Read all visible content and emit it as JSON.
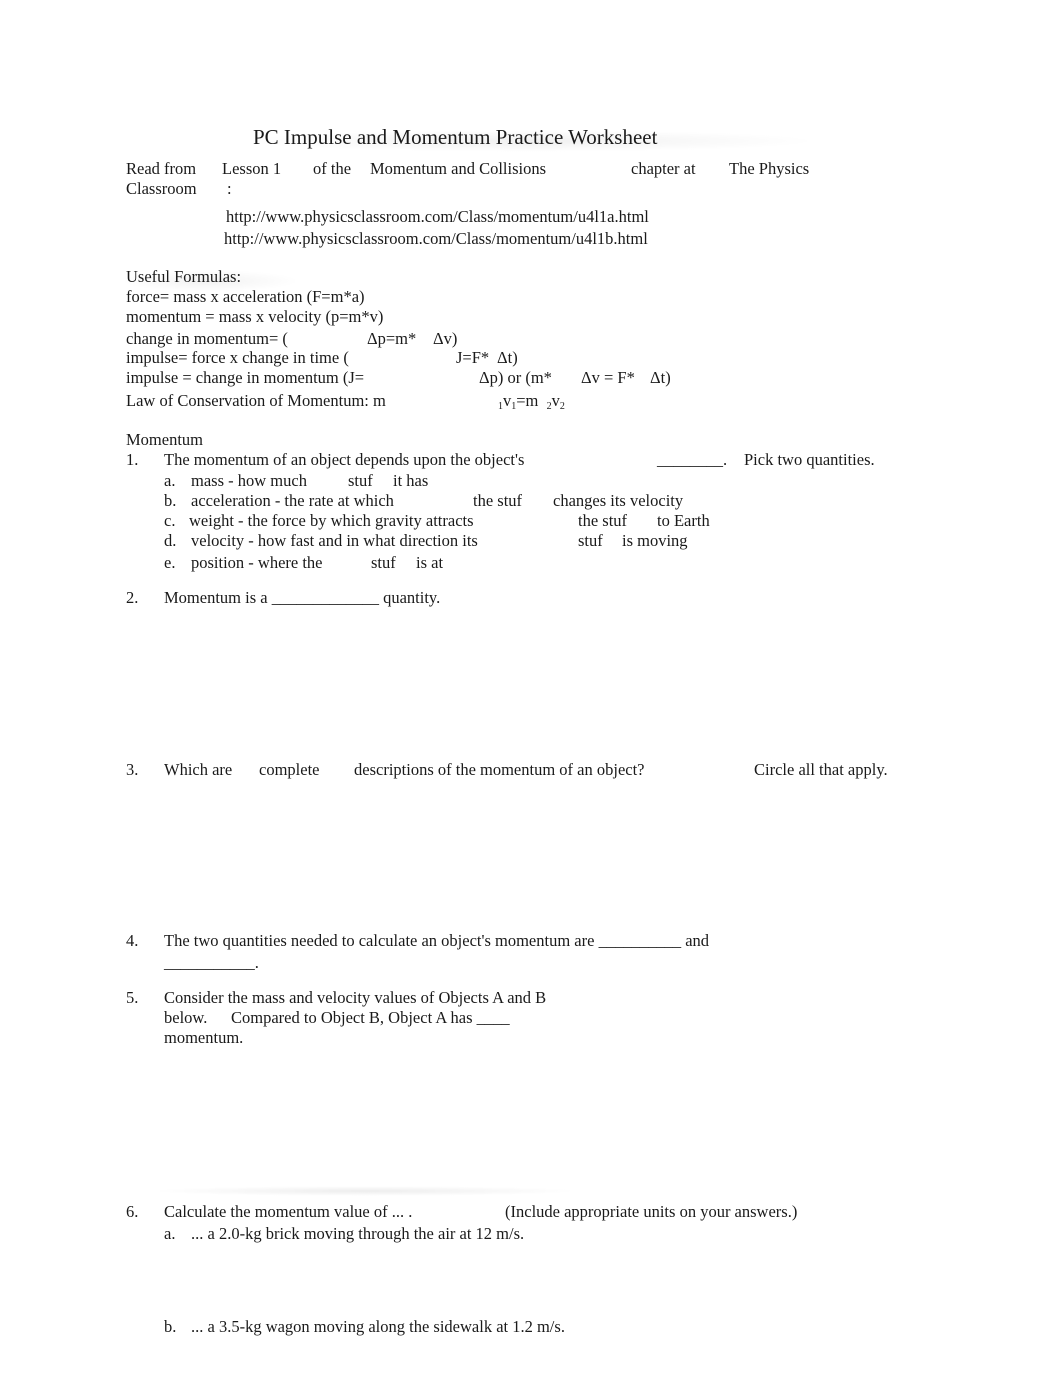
{
  "document": {
    "title": "PC Impulse and Momentum Practice Worksheet",
    "intro": {
      "read_from": "Read from",
      "lesson": "Lesson 1",
      "of_the": "of the",
      "chapter_name": "Momentum and Collisions",
      "chapter_at": "chapter at",
      "site_part1": "The Physics",
      "site_part2": "Classroom",
      "colon": ":",
      "links": [
        "http://www.physicsclassroom.com/Class/momentum/u4l1a.html",
        "http://www.physicsclassroom.com/Class/momentum/u4l1b.html"
      ]
    },
    "formulas": {
      "heading": "Useful Formulas:",
      "lines": [
        {
          "a": "force= mass x acceleration (F=m*a)"
        },
        {
          "a": "momentum = mass x velocity (p=m*v)"
        },
        {
          "a": "change in momentum= (",
          "b": "Δp=m*",
          "c": "Δv)"
        },
        {
          "a": "impulse= force x change in time (",
          "b": "J=F*",
          "c": "Δt)"
        },
        {
          "a": "impulse = change in momentum (J=",
          "b": "Δp) or (m*",
          "c": "Δv = F*",
          "d": "Δt)"
        },
        {
          "a": "Law of Conservation of Momentum: m",
          "s1": "1",
          "v1": "v",
          "s2": "1",
          "eq": "=m",
          "s3": "2",
          "v2": "v",
          "s4": "2"
        }
      ]
    },
    "section_heading": "Momentum",
    "questions": {
      "q1": {
        "num": "1.",
        "text": "The momentum of an object depends upon the object's",
        "blank": "________.",
        "tail": "Pick two quantities.",
        "options": [
          {
            "letter": "a.",
            "p1": "mass - how much",
            "p2": "stuf",
            "p3": "it has"
          },
          {
            "letter": "b.",
            "p1": "acceleration - the rate at which",
            "p2": "the stuf",
            "p3": "changes its velocity"
          },
          {
            "letter": "c.",
            "p1": "weight - the force by which gravity attracts",
            "p2": "the stuf",
            "p3": "to Earth"
          },
          {
            "letter": "d.",
            "p1": "velocity - how fast and in what direction its",
            "p2": "stuf",
            "p3": "is moving"
          },
          {
            "letter": "e.",
            "p1": "position - where the",
            "p2": "stuf",
            "p3": "is at"
          }
        ]
      },
      "q2": {
        "num": "2.",
        "text": "Momentum is a _____________ quantity."
      },
      "q3": {
        "num": "3.",
        "p1": "Which are",
        "p2": "complete",
        "p3": "descriptions of the momentum of an object?",
        "p4": "Circle all that apply."
      },
      "q4": {
        "num": "4.",
        "line1": "The two quantities needed to calculate an object's momentum are __________ and",
        "line2": "___________."
      },
      "q5": {
        "num": "5.",
        "line1": "Consider the mass and velocity values of Objects A and B",
        "line2a": "below.",
        "line2b": "Compared to Object B, Object A has ____",
        "line3": "momentum."
      },
      "q6": {
        "num": "6.",
        "text": "Calculate the momentum value of ... .",
        "note": "(Include appropriate units on your answers.)",
        "parts": [
          {
            "letter": "a.",
            "text": "... a 2.0-kg brick moving through the air at 12 m/s."
          },
          {
            "letter": "b.",
            "text": "... a 3.5-kg wagon moving along the sidewalk at 1.2 m/s."
          }
        ]
      }
    }
  }
}
